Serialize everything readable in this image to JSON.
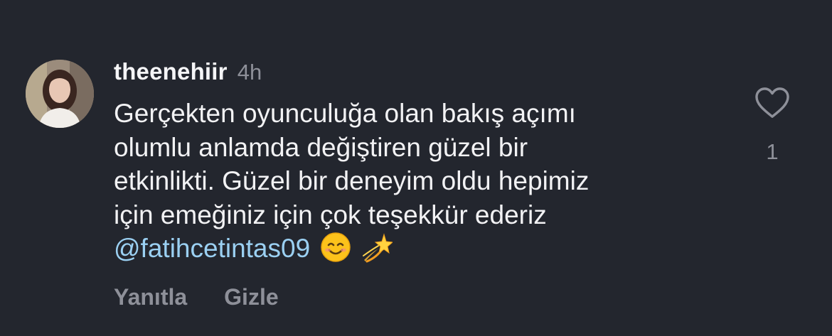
{
  "comment": {
    "username": "theenehiir",
    "time": "4h",
    "text_lines": [
      "Gerçekten oyunculuğa olan bakış açımı",
      "olumlu anlamda değiştiren güzel bir",
      "etkinlikti. Güzel bir deneyim oldu hepimiz",
      "için emeğiniz için çok teşekkür ederiz"
    ],
    "mention": "@fatihcetintas09",
    "emojis": [
      "smiling-face-icon",
      "dizzy-star-icon"
    ],
    "like_count": "1"
  },
  "actions": {
    "reply_label": "Yanıtla",
    "hide_label": "Gizle"
  },
  "colors": {
    "background": "#23262e",
    "mention": "#9bd0f2",
    "muted": "#8e9099"
  }
}
